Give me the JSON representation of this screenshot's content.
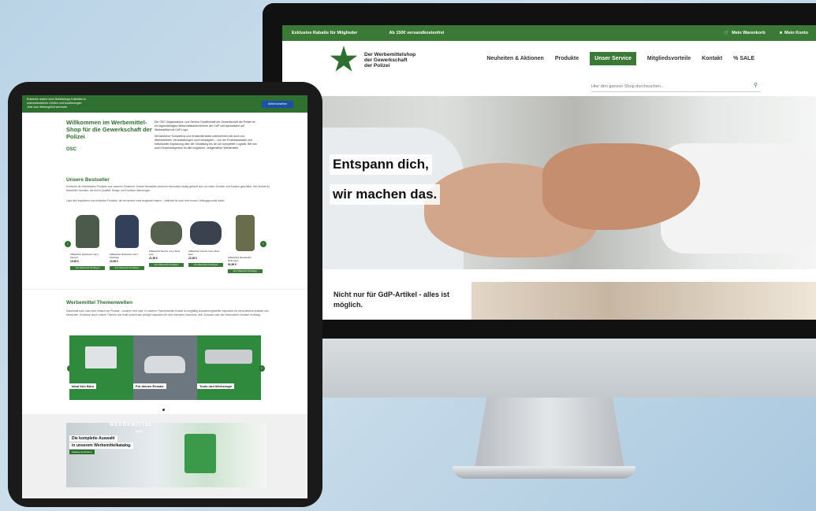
{
  "colors": {
    "brand": "#3a7a36",
    "brand_dark": "#2f6f2f",
    "link_blue": "#1c4fa8"
  },
  "desktop": {
    "topbar": {
      "left": "Exklusive Rabatte für Mitglieder",
      "center": "Ab 150€ versandkostenfrei",
      "cart": "Mein Warenkorb",
      "account": "Mein Konto"
    },
    "logo": {
      "line1": "Der Werbemittelshop",
      "line2": "der Gewerkschaft",
      "line3": "der Polizei"
    },
    "nav": [
      "Neuheiten & Aktionen",
      "Produkte",
      "Unser Service",
      "Mitgliedsvorteile",
      "Kontakt",
      "% SALE"
    ],
    "search": {
      "placeholder": "Hier den ganzen Shop durchsuchen..."
    },
    "hero": {
      "line1": "Entspann dich,",
      "line2": "wir machen das."
    },
    "sub": {
      "text": "Nicht nur für GdP-Artikel - alles ist möglich."
    }
  },
  "tablet": {
    "topbar": {
      "line1": "Entdecke unsere neue Bekleidungs-Kollektion in",
      "line2": "unterschiedlichen Größen und Ausführungen.",
      "line3": "Jetzt zum Webangebot wechseln",
      "button": "Artikel ansehen"
    },
    "welcome": {
      "title": "Willkommen im Werbemittel-Shop für die Gewerkschaft der Polizei",
      "text1": "Die OSC Organisations- und Service-Gesellschaft der Gewerkschaft der Polizei ist ein eigenständiges Wirtschaftsunternehmen der GdP und spezialisiert auf Werbeartikel mit GdP-Logo.",
      "text2": "Mit fachlicher Kompetenz und Kreativität bietet unternehmen wir auch von Werbeartikeln, Veranstaltungen und Kampagnen – von der Produktauswahl und individueller Anpassung über die Gestaltung bis hin zur kompletten Logistik. Bei uns auch Einzelstückpreise für alle möglichen, zeitgemäßen Werbemittel.",
      "badge": "OSC"
    },
    "bestseller": {
      "title": "Unsere Bestseller",
      "intro": "Entdecke die beliebtesten Produkte aus unserem Sortiment. Unsere Bestseller zeichnen besonders häufig gekauft und von vielen Kunden und Kunden geschätzt. Hier findest du bewährte Favoriten, die durch Qualität, Design und Funktion überzeugen.",
      "intro2": "Lass dich inspirieren und entdecke Produkte, die bei andere viele begeistert haben – vielleicht ist auch dein neues Lieblingsprodukt dabei.",
      "items": [
        {
          "name": "inBlackSul Rucksack Carry Pariserl",
          "price": "19,99 €",
          "color": "#4b5a4a",
          "button": "Zum Warenkorb hinzufügen"
        },
        {
          "name": "inBlackSul Rucksack Carry Parbblau",
          "price": "19,99 €",
          "color": "#33405a",
          "button": "Zum Warenkorb hinzufügen"
        },
        {
          "name": "inBlackSul Tasche Carry Briel grün",
          "price": "21,99 €",
          "color": "#55604f",
          "button": "Zum Warenkorb hinzufügen"
        },
        {
          "name": "inBlackSul Tasche Carry Briel blau",
          "price": "22,99 €",
          "color": "#3a4250",
          "button": "Zum Warenkorb hinzufügen"
        },
        {
          "name": "inBlackSul Reisekoffer Rollergrün",
          "price": "92,99 €",
          "color": "#6a6d4c",
          "button": "Zum Warenkorb hinzufügen"
        }
      ]
    },
    "themes": {
      "title": "Werbemittel Themenwelten",
      "text": "Manchmal such man nicht einfach ein Produkt – sondern eine Idee. In unseren Themenwelten findest du sorgfältig zusammengestellte Inspiration für verschiedene Anlässe und Menschen. Entdecke durch unsere Themen und finde schnell das richtige Inspiration für dein nächstes Geschenk, dein Zuhause oder den besonderen Moment im Alltag.",
      "tiles": [
        {
          "label": "Ideal fürs Büro",
          "color": "#2f8a3e"
        },
        {
          "label": "Für deinen Einsatz",
          "color": "#6d7780"
        },
        {
          "label": "Tools und Werkzeuge",
          "color": "#2f8a3e"
        }
      ]
    },
    "catalog": {
      "big": "WERBEMITTEL",
      "year": "2026",
      "line1": "Die komplette Auswahl",
      "line2": "in unserem Werbemittelkatalog.",
      "badge": "Katalog anschauen"
    }
  }
}
